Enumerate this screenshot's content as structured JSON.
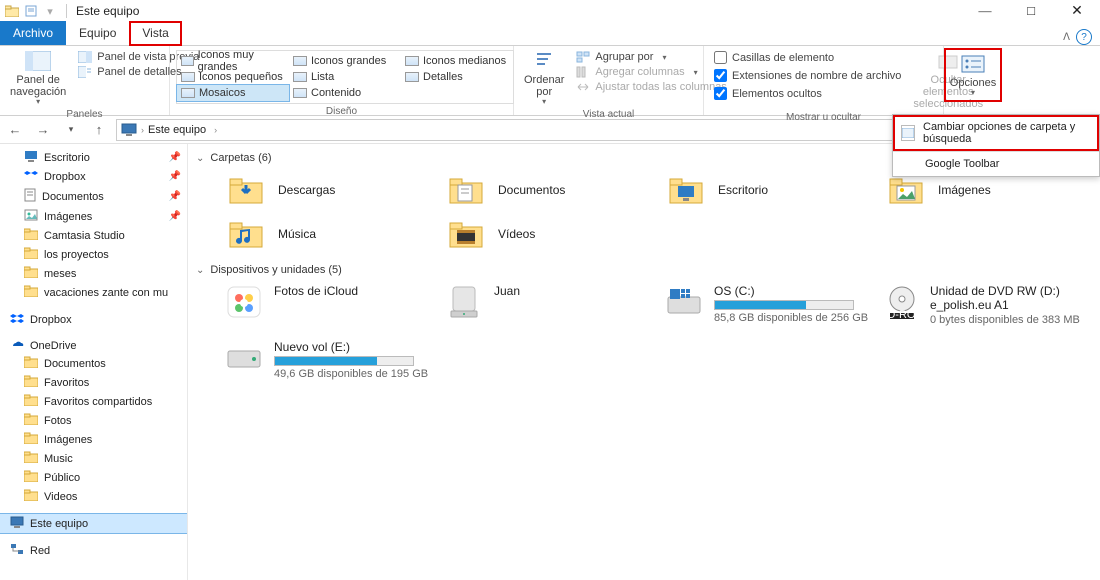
{
  "window": {
    "title": "Este equipo"
  },
  "tabs": {
    "file": "Archivo",
    "equipo": "Equipo",
    "vista": "Vista"
  },
  "ribbon": {
    "nav_panel": "Panel de\nnavegación",
    "preview_pane": "Panel de vista previa",
    "details_pane": "Panel de detalles",
    "panels_label": "Paneles",
    "views": [
      "Iconos muy grandes",
      "Iconos grandes",
      "Iconos medianos",
      "Iconos pequeños",
      "Lista",
      "Detalles",
      "Mosaicos",
      "Contenido"
    ],
    "layout_label": "Diseño",
    "sort_by": "Ordenar\npor",
    "group_by": "Agrupar por",
    "add_cols": "Agregar columnas",
    "fit_cols": "Ajustar todas las columnas",
    "current_view_label": "Vista actual",
    "cb_item_boxes": "Casillas de elemento",
    "cb_ext": "Extensiones de nombre de archivo",
    "cb_hidden": "Elementos ocultos",
    "hide_sel": "Ocultar elementos\nseleccionados",
    "show_hide_label": "Mostrar u ocultar",
    "options": "Opciones",
    "flyout_change": "Cambiar opciones de carpeta y búsqueda",
    "flyout_google": "Google Toolbar"
  },
  "breadcrumb": {
    "root": "Este equipo"
  },
  "sidebar": {
    "quick": [
      {
        "k": "escritorio",
        "label": "Escritorio",
        "pin": true
      },
      {
        "k": "dropbox-q",
        "label": "Dropbox",
        "pin": true
      },
      {
        "k": "documentos-q",
        "label": "Documentos",
        "pin": true
      },
      {
        "k": "imagenes-q",
        "label": "Imágenes",
        "pin": true
      },
      {
        "k": "camtasia",
        "label": "Camtasia Studio",
        "pin": false
      },
      {
        "k": "losproyectos",
        "label": "los proyectos",
        "pin": false
      },
      {
        "k": "meses",
        "label": "meses",
        "pin": false
      },
      {
        "k": "vacaciones",
        "label": "vacaciones zante con mu",
        "pin": false
      }
    ],
    "dropbox": "Dropbox",
    "onedrive": "OneDrive",
    "onedrive_children": [
      "Documentos",
      "Favoritos",
      "Favoritos compartidos",
      "Fotos",
      "Imágenes",
      "Music",
      "Público",
      "Videos"
    ],
    "este_equipo": "Este equipo",
    "red": "Red"
  },
  "sections": {
    "folders_title": "Carpetas (6)",
    "folders": [
      {
        "k": "descargas",
        "label": "Descargas"
      },
      {
        "k": "documentos",
        "label": "Documentos"
      },
      {
        "k": "escritorio",
        "label": "Escritorio"
      },
      {
        "k": "imagenes",
        "label": "Imágenes"
      },
      {
        "k": "musica",
        "label": "Música"
      },
      {
        "k": "videos",
        "label": "Vídeos"
      }
    ],
    "devices_title": "Dispositivos y unidades (5)",
    "devices": [
      {
        "k": "icloud",
        "name": "Fotos de iCloud",
        "sub": "",
        "bar": null
      },
      {
        "k": "juan",
        "name": "Juan",
        "sub": "",
        "bar": null
      },
      {
        "k": "osc",
        "name": "OS (C:)",
        "sub": "85,8 GB disponibles de 256 GB",
        "bar": 0.66
      },
      {
        "k": "dvd",
        "name": "Unidad de DVD RW (D:) e_polish.eu A1",
        "sub": "0 bytes disponibles de 383 MB",
        "bar": null
      },
      {
        "k": "nuevo",
        "name": "Nuevo vol (E:)",
        "sub": "49,6 GB disponibles de 195 GB",
        "bar": 0.74
      }
    ]
  }
}
